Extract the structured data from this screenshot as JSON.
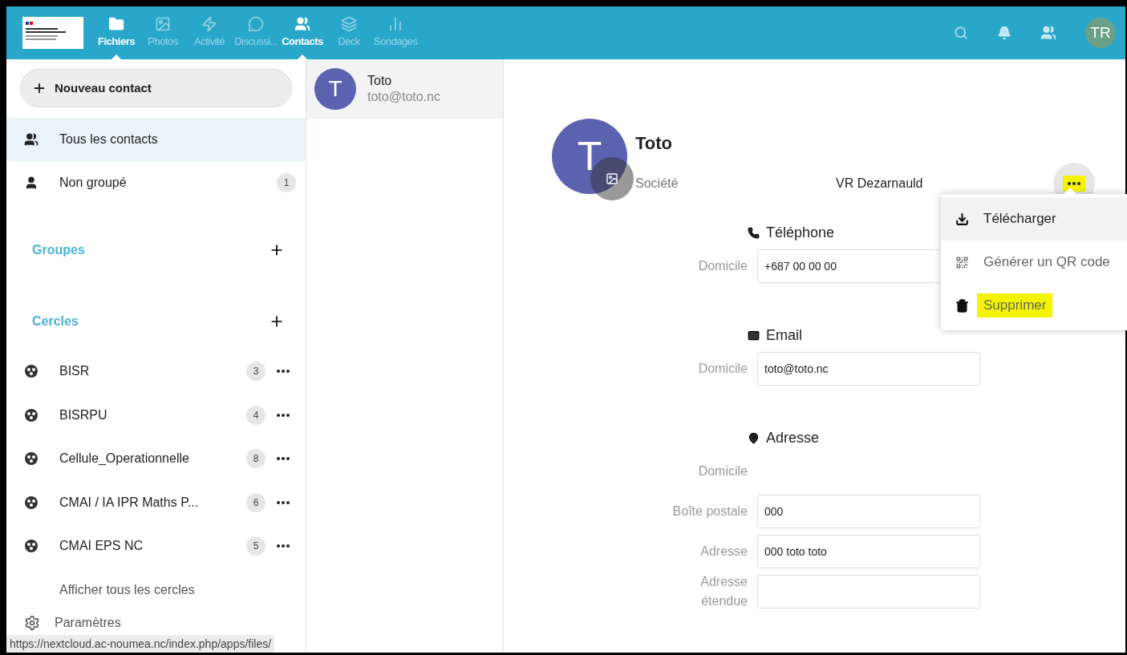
{
  "header": {
    "apps": [
      {
        "label": "Fichiers",
        "kind": "folder",
        "selected": true
      },
      {
        "label": "Photos",
        "kind": "image",
        "selected": false
      },
      {
        "label": "Activité",
        "kind": "bolt",
        "selected": false
      },
      {
        "label": "Discussi...",
        "kind": "talk",
        "selected": false
      },
      {
        "label": "Contacts",
        "kind": "contacts",
        "selected": true
      },
      {
        "label": "Deck",
        "kind": "deck",
        "selected": false
      },
      {
        "label": "Sondages",
        "kind": "poll",
        "selected": false
      }
    ],
    "avatar": "TR"
  },
  "sidebar": {
    "new_button": "Nouveau contact",
    "items": [
      {
        "label": "Tous les contacts",
        "kind": "group",
        "selected": true
      },
      {
        "label": "Non groupé",
        "kind": "user",
        "count": "1",
        "selected": false
      }
    ],
    "groups_title": "Groupes",
    "circles_title": "Cercles",
    "circles": [
      {
        "label": "BISR",
        "count": "3"
      },
      {
        "label": "BISRPU",
        "count": "4"
      },
      {
        "label": "Cellule_Operationnelle",
        "count": "8"
      },
      {
        "label": "CMAI / IA IPR Maths P...",
        "count": "6"
      },
      {
        "label": "CMAI EPS NC",
        "count": "5"
      }
    ],
    "show_all": "Afficher tous les cercles",
    "settings": "Paramètres"
  },
  "contact_list": [
    {
      "initial": "T",
      "name": "Toto",
      "email": "toto@toto.nc",
      "selected": true
    }
  ],
  "details": {
    "initial": "T",
    "name": "Toto",
    "org_label": "Société",
    "org_value": "VR Dezarnauld",
    "more_highlighted": true,
    "menu": [
      {
        "label": "Télécharger",
        "kind": "download",
        "hovered": true,
        "highlighted": false
      },
      {
        "label": "Générer un QR code",
        "kind": "qr",
        "hovered": false,
        "highlighted": false
      },
      {
        "label": "Supprimer",
        "kind": "trash",
        "hovered": false,
        "highlighted": true
      }
    ],
    "sections": [
      {
        "title": "Téléphone",
        "kind": "phone",
        "fields": [
          {
            "label": "Domicile",
            "value": "+687 00 00 00"
          }
        ]
      },
      {
        "title": "Email",
        "kind": "mail",
        "fields": [
          {
            "label": "Domicile",
            "value": "toto@toto.nc"
          }
        ]
      },
      {
        "title": "Adresse",
        "kind": "pin",
        "fields": [
          {
            "label": "Domicile",
            "kind": "label"
          },
          {
            "label": "Boîte postale",
            "value": "000"
          },
          {
            "label": "Adresse",
            "value": "000 toto toto"
          },
          {
            "label": "Adresse étendue"
          }
        ]
      }
    ]
  },
  "status_bar": "https://nextcloud.ac-noumea.nc/index.php/apps/files/"
}
